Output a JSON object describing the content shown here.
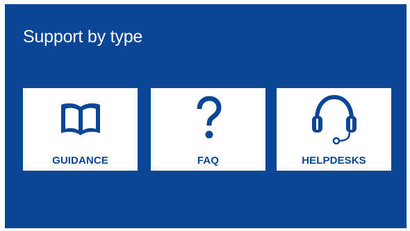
{
  "section": {
    "title": "Support by type"
  },
  "tiles": [
    {
      "label": "GUIDANCE",
      "icon": "book-icon"
    },
    {
      "label": "FAQ",
      "icon": "question-mark-icon"
    },
    {
      "label": "HELPDESKS",
      "icon": "headset-icon"
    }
  ],
  "colors": {
    "background": "#0a4596",
    "tile": "#ffffff",
    "accent": "#0a4596"
  }
}
